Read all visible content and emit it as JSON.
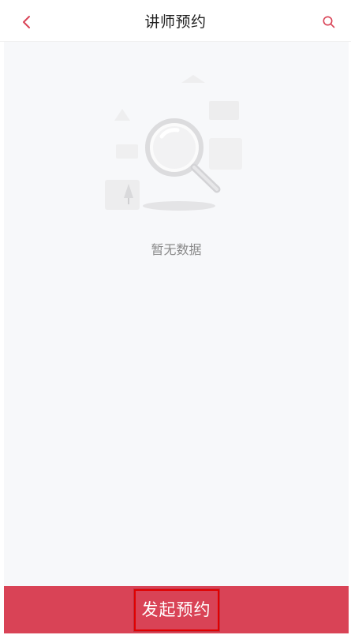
{
  "header": {
    "title": "讲师预约",
    "back_icon": "chevron-left-icon",
    "search_icon": "search-icon",
    "accent_color": "#d94356"
  },
  "empty_state": {
    "illustration": "magnifier-empty-icon",
    "message": "暂无数据"
  },
  "footer": {
    "button_label": "发起预约",
    "button_color": "#d94356"
  }
}
